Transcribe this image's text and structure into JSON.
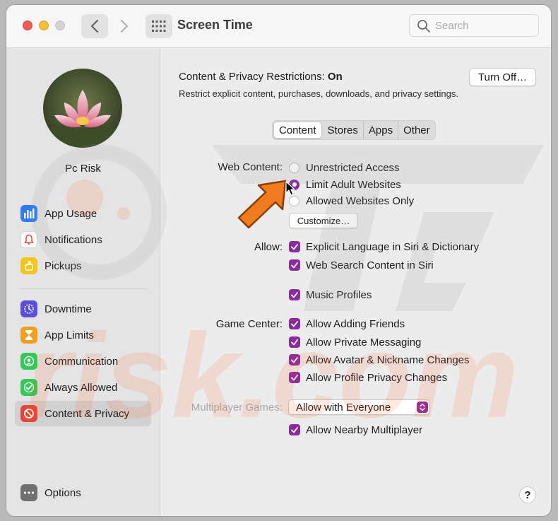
{
  "window": {
    "title": "Screen Time",
    "search_placeholder": "Search"
  },
  "sidebar": {
    "user_name": "Pc Risk",
    "items": [
      {
        "label": "App Usage",
        "icon": "bar-chart-icon",
        "color": "#2f7cf6"
      },
      {
        "label": "Notifications",
        "icon": "bell-icon",
        "color": "#ffffff"
      },
      {
        "label": "Pickups",
        "icon": "pickup-icon",
        "color": "#f5c518"
      },
      {
        "label": "Downtime",
        "icon": "downtime-icon",
        "color": "#5b4fd8"
      },
      {
        "label": "App Limits",
        "icon": "hourglass-icon",
        "color": "#f0a020"
      },
      {
        "label": "Communication",
        "icon": "person-icon",
        "color": "#34c759"
      },
      {
        "label": "Always Allowed",
        "icon": "checkmark-icon",
        "color": "#34c759"
      },
      {
        "label": "Content & Privacy",
        "icon": "no-entry-icon",
        "color": "#e5453a"
      }
    ],
    "options_label": "Options"
  },
  "main": {
    "restrictions_label": "Content & Privacy Restrictions:",
    "restrictions_state": "On",
    "restrictions_subtitle": "Restrict explicit content, purchases, downloads, and privacy settings.",
    "turn_off_label": "Turn Off…",
    "tabs": [
      "Content",
      "Stores",
      "Apps",
      "Other"
    ],
    "active_tab": "Content",
    "web_content_label": "Web Content:",
    "web_options": [
      "Unrestricted Access",
      "Limit Adult Websites",
      "Allowed Websites Only"
    ],
    "web_selected": "Limit Adult Websites",
    "customize_label": "Customize…",
    "allow_label": "Allow:",
    "allow_items": [
      "Explicit Language in Siri & Dictionary",
      "Web Search Content in Siri",
      "Music Profiles"
    ],
    "game_center_label": "Game Center:",
    "game_items": [
      "Allow Adding Friends",
      "Allow Private Messaging",
      "Allow Avatar & Nickname Changes",
      "Allow Profile Privacy Changes"
    ],
    "multiplayer_label": "Multiplayer Games:",
    "multiplayer_value": "Allow with Everyone",
    "nearby_label": "Allow Nearby Multiplayer",
    "help_label": "?"
  },
  "colors": {
    "accent": "#8c2ba0",
    "annotation_arrow": "#f07a1e"
  }
}
